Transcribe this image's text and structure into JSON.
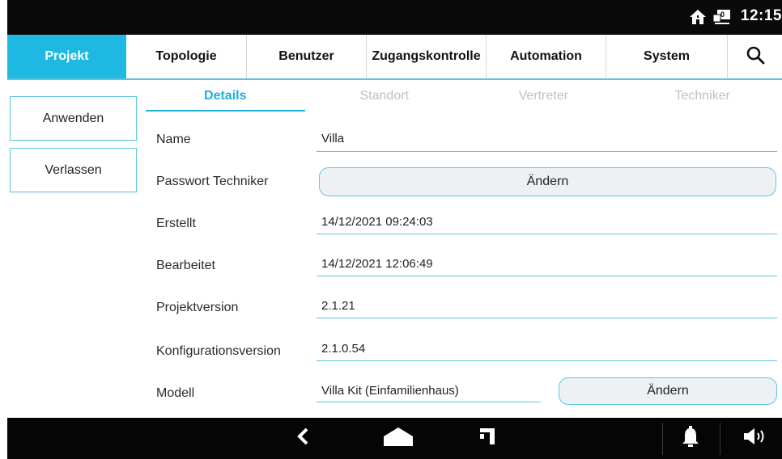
{
  "status_bar": {
    "time": "12:15",
    "icons": [
      "home-icon",
      "network-icon"
    ],
    "network_badge": "0"
  },
  "main_nav": {
    "tabs": [
      {
        "label": "Projekt",
        "active": true
      },
      {
        "label": "Topologie",
        "active": false
      },
      {
        "label": "Benutzer",
        "active": false
      },
      {
        "label": "Zugangskontrolle",
        "active": false
      },
      {
        "label": "Automation",
        "active": false
      },
      {
        "label": "System",
        "active": false
      }
    ],
    "search_icon": "search-icon"
  },
  "actions": {
    "apply_label": "Anwenden",
    "exit_label": "Verlassen"
  },
  "sub_tabs": [
    {
      "label": "Details",
      "active": true
    },
    {
      "label": "Standort",
      "active": false
    },
    {
      "label": "Vertreter",
      "active": false
    },
    {
      "label": "Techniker",
      "active": false
    }
  ],
  "details": {
    "name": {
      "label": "Name",
      "value": "Villa"
    },
    "password": {
      "label": "Passwort Techniker",
      "button": "Ändern"
    },
    "created": {
      "label": "Erstellt",
      "value": "14/12/2021 09:24:03"
    },
    "edited": {
      "label": "Bearbeitet",
      "value": "14/12/2021 12:06:49"
    },
    "project_version": {
      "label": "Projektversion",
      "value": "2.1.21"
    },
    "config_version": {
      "label": "Konfigurationsversion",
      "value": "2.1.0.54"
    },
    "model": {
      "label": "Modell",
      "value": "Villa Kit (Einfamilienhaus)",
      "button": "Ändern"
    }
  },
  "bottom_bar": {
    "icons": [
      "back-icon",
      "home-icon",
      "recent-apps-icon",
      "bell-icon",
      "volume-icon"
    ]
  },
  "colors": {
    "accent": "#1fb8e2",
    "line": "#59c6e0",
    "dark_bar": "#0a0a0a",
    "inactive_tab_text": "#c0c0c0"
  }
}
